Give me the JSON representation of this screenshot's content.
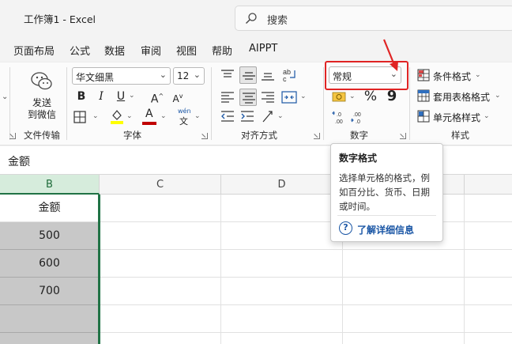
{
  "window": {
    "title": "工作簿1  -  Excel"
  },
  "search": {
    "placeholder": "搜索"
  },
  "menu": [
    "页面布局",
    "公式",
    "数据",
    "审阅",
    "视图",
    "帮助",
    "AIPPT"
  ],
  "ribbon": {
    "wechat": {
      "label_line1": "发送",
      "label_line2": "到微信",
      "group": "文件传输"
    },
    "font": {
      "name": "华文细黑",
      "size": "12",
      "bold": "B",
      "italic": "I",
      "underline": "U",
      "grow": "A",
      "shrink": "A",
      "font_color_letter": "A",
      "phonetic_top": "wén",
      "phonetic_bottom": "文",
      "group": "字体"
    },
    "alignment": {
      "group": "对齐方式"
    },
    "number": {
      "format": "常规",
      "percent": "%",
      "comma": "9",
      "group": "数字"
    },
    "styles": {
      "conditional": "条件格式",
      "table": "套用表格格式",
      "cell": "单元格样式",
      "group": "样式"
    }
  },
  "namebox": {
    "value": "金额"
  },
  "columns": [
    "B",
    "C",
    "D"
  ],
  "cells": {
    "header": "金额",
    "values": [
      "500",
      "600",
      "700"
    ]
  },
  "tooltip": {
    "title": "数字格式",
    "description": "选择单元格的格式，例如百分比、货币、日期或时间。",
    "link": "了解详细信息",
    "help_glyph": "?"
  },
  "colors": {
    "accent_green": "#217346",
    "highlight_red": "#e02424",
    "link_blue": "#1a56a5"
  }
}
